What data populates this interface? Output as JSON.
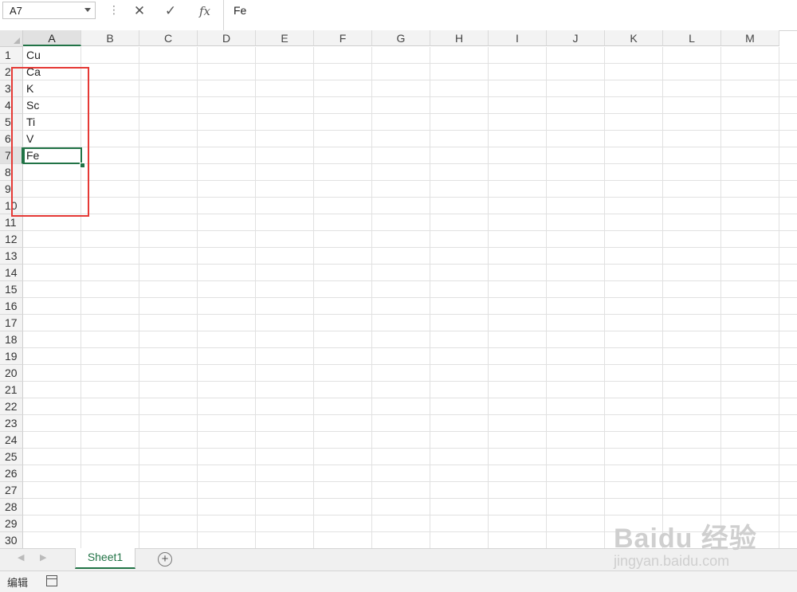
{
  "formula_bar": {
    "name_box": "A7",
    "formula": "Fe",
    "separator": "⋮",
    "cancel_glyph": "✕",
    "enter_glyph": "✓",
    "fx_glyph": "fx"
  },
  "columns": [
    "A",
    "B",
    "C",
    "D",
    "E",
    "F",
    "G",
    "H",
    "I",
    "J",
    "K",
    "L",
    "M"
  ],
  "selected_column": "A",
  "rows": [
    "1",
    "2",
    "3",
    "4",
    "5",
    "6",
    "7",
    "8",
    "9",
    "10",
    "11",
    "12",
    "13",
    "14",
    "15",
    "16",
    "17",
    "18",
    "19",
    "20",
    "21",
    "22",
    "23",
    "24",
    "25",
    "26",
    "27",
    "28",
    "29",
    "30"
  ],
  "selected_row": "7",
  "cells_a": [
    "Cu",
    "Ca",
    "K",
    "Sc",
    "Ti",
    "V",
    "Fe"
  ],
  "active_cell": "A7",
  "sheet_tab": "Sheet1",
  "add_sheet": "+",
  "status": {
    "mode": "编辑"
  },
  "watermark": {
    "brand": "Baidu 经验",
    "url": "jingyan.baidu.com"
  },
  "colors": {
    "accent": "#217346",
    "highlight": "#e53935"
  },
  "icons": [
    "chevron-down-icon",
    "cancel-icon",
    "check-icon",
    "fx-icon",
    "nav-prev-icon",
    "nav-next-icon",
    "add-sheet-icon",
    "macro-icon"
  ]
}
